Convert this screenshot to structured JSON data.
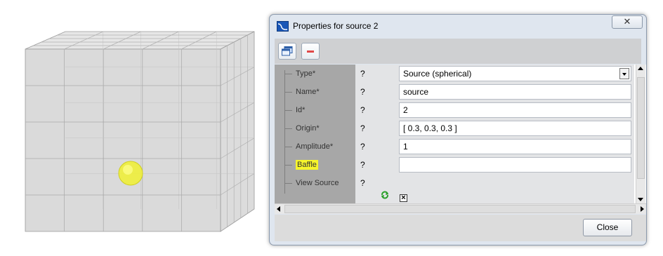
{
  "dialog": {
    "title": "Properties for source 2",
    "close_glyph": "✕",
    "toolbar": {
      "buttons": [
        {
          "name": "windows-icon"
        },
        {
          "name": "remove-icon"
        }
      ]
    },
    "rows": [
      {
        "label": "Type*",
        "help": "?",
        "value": "Source (spherical)",
        "kind": "dropdown"
      },
      {
        "label": "Name*",
        "help": "?",
        "value": "source",
        "kind": "text"
      },
      {
        "label": "Id*",
        "help": "?",
        "value": "2",
        "kind": "text"
      },
      {
        "label": "Origin*",
        "help": "?",
        "value": "[ 0.3, 0.3, 0.3 ]",
        "kind": "text"
      },
      {
        "label": "Amplitude*",
        "help": "?",
        "value": "1",
        "kind": "text"
      },
      {
        "label": "Baffle",
        "help": "?",
        "value": "",
        "kind": "text",
        "highlighted": true
      },
      {
        "label": "View Source",
        "help": "?",
        "checked": true,
        "check_glyph": "×",
        "kind": "checkbox"
      }
    ],
    "close_button": "Close"
  },
  "colors": {
    "highlight": "#f6f52b",
    "sphere": "#f0f030",
    "remove": "#e04848"
  }
}
